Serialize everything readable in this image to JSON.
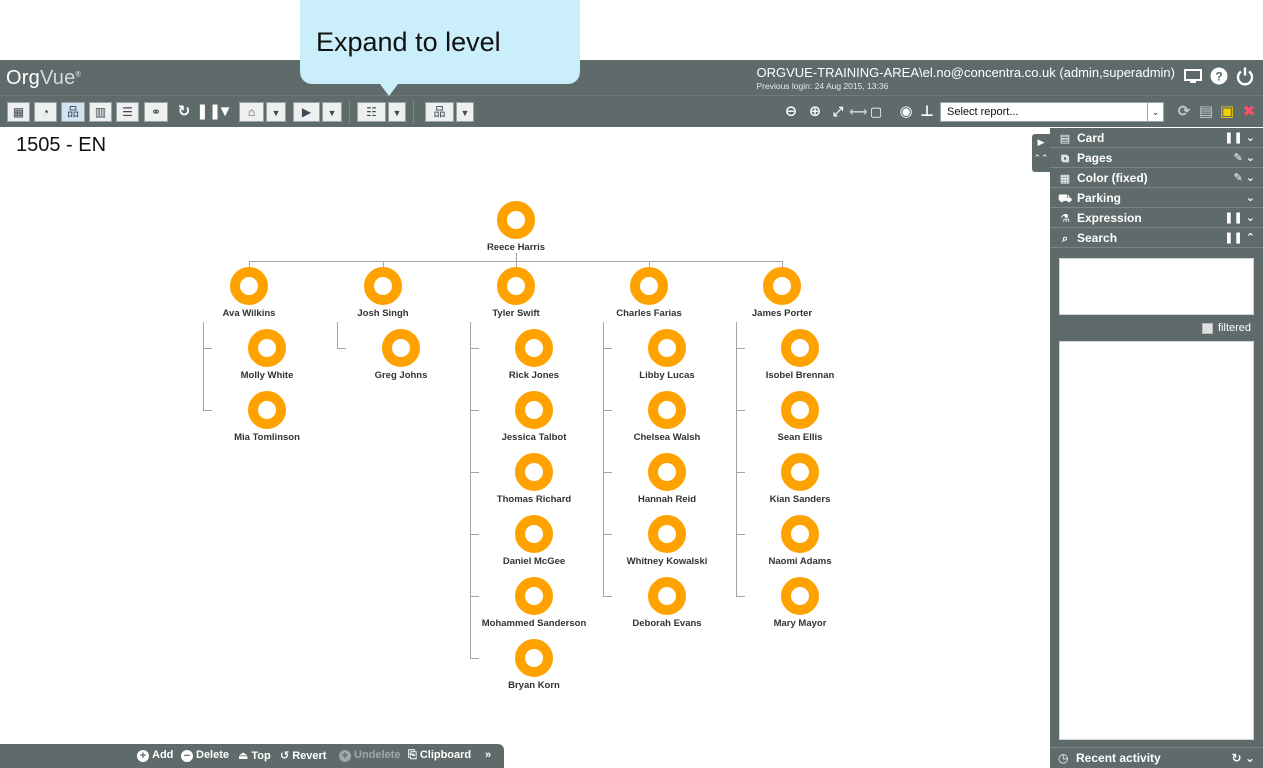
{
  "tooltip": {
    "text": "Expand to level"
  },
  "header": {
    "logo_org": "Org",
    "logo_vue": "Vue",
    "user": "ORGVUE-TRAINING-AREA\\el.no@concentra.co.uk (admin,superadmin)",
    "previous_login": "Previous login: 24 Aug 2015, 13:36",
    "icons": [
      "monitor-icon",
      "help-icon",
      "power-icon"
    ]
  },
  "toolbar": {
    "report_placeholder": "Select report..."
  },
  "page": {
    "title": "1505 - EN"
  },
  "org": {
    "root": "Reece Harris",
    "managers": [
      "Ava Wilkins",
      "Josh Singh",
      "Tyler Swift",
      "Charles Farias",
      "James Porter"
    ],
    "reports": [
      [
        "Molly White",
        "Mia Tomlinson"
      ],
      [
        "Greg Johns"
      ],
      [
        "Rick Jones",
        "Jessica Talbot",
        "Thomas Richard",
        "Daniel McGee",
        "Mohammed Sanderson",
        "Bryan Korn"
      ],
      [
        "Libby Lucas",
        "Chelsea Walsh",
        "Hannah Reid",
        "Whitney Kowalski",
        "Deborah Evans"
      ],
      [
        "Isobel Brennan",
        "Sean Ellis",
        "Kian Sanders",
        "Naomi Adams",
        "Mary Mayor"
      ]
    ]
  },
  "panel": {
    "sections": [
      {
        "label": "Card",
        "icon": "card-icon",
        "right": "❚❚ ⌄"
      },
      {
        "label": "Pages",
        "icon": "pages-icon",
        "right": "✎ ⌄"
      },
      {
        "label": "Color (fixed)",
        "icon": "grid-icon",
        "right": "✎ ⌄"
      },
      {
        "label": "Parking",
        "icon": "truck-icon",
        "right": "⌄"
      },
      {
        "label": "Expression",
        "icon": "flask-icon",
        "right": "❚❚ ⌄"
      },
      {
        "label": "Search",
        "icon": "search-icon",
        "right": "❚❚ ⌃"
      }
    ],
    "filtered_label": "filtered",
    "recent_activity": "Recent activity"
  },
  "edit_bar": {
    "add": "Add",
    "delete": "Delete",
    "top": "Top",
    "revert": "Revert",
    "undelete": "Undelete",
    "clipboard": "Clipboard",
    "more": "»"
  }
}
